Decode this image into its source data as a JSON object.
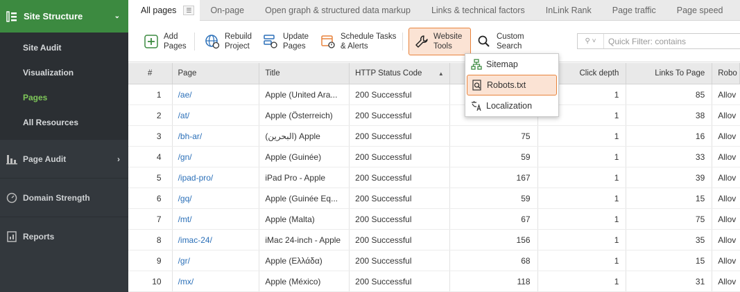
{
  "sidebar": {
    "header": "Site Structure",
    "sub_items": [
      {
        "label": "Site Audit",
        "active": false
      },
      {
        "label": "Visualization",
        "active": false
      },
      {
        "label": "Pages",
        "active": true
      },
      {
        "label": "All Resources",
        "active": false
      }
    ],
    "sections": [
      {
        "label": "Page Audit",
        "icon": "bar-chart-icon"
      },
      {
        "label": "Domain Strength",
        "icon": "gauge-icon"
      },
      {
        "label": "Reports",
        "icon": "report-icon"
      }
    ]
  },
  "tabs": [
    "All pages",
    "On-page",
    "Open graph & structured data markup",
    "Links & technical factors",
    "InLink Rank",
    "Page traffic",
    "Page speed"
  ],
  "toolbar": {
    "add": [
      "Add",
      "Pages"
    ],
    "rebuild": [
      "Rebuild",
      "Project"
    ],
    "update": [
      "Update",
      "Pages"
    ],
    "schedule": [
      "Schedule Tasks",
      "& Alerts"
    ],
    "website_tools": [
      "Website",
      "Tools"
    ],
    "custom_search": [
      "Custom",
      "Search"
    ],
    "filter_placeholder": "Quick Filter: contains"
  },
  "dropdown": {
    "items": [
      {
        "label": "Sitemap",
        "icon": "sitemap-icon"
      },
      {
        "label": "Robots.txt",
        "icon": "robots-file-icon",
        "highlighted": true
      },
      {
        "label": "Localization",
        "icon": "translate-icon"
      }
    ]
  },
  "table": {
    "headers": {
      "num": "#",
      "page": "Page",
      "title": "Title",
      "http": "HTTP Status Code",
      "depth": "Click depth",
      "links": "Links To Page",
      "robots": "Robo"
    },
    "rows": [
      {
        "num": "1",
        "page": "/ae/",
        "title": "Apple (United Ara...",
        "http": "200 Successful",
        "load": "",
        "depth": "1",
        "links": "85",
        "robots": "Allov"
      },
      {
        "num": "2",
        "page": "/at/",
        "title": "Apple (Österreich)",
        "http": "200 Successful",
        "load": "",
        "depth": "1",
        "links": "38",
        "robots": "Allov"
      },
      {
        "num": "3",
        "page": "/bh-ar/",
        "title": "(البحرين) Apple",
        "http": "200 Successful",
        "load": "75",
        "depth": "1",
        "links": "16",
        "robots": "Allov"
      },
      {
        "num": "4",
        "page": "/gn/",
        "title": "Apple (Guinée)",
        "http": "200 Successful",
        "load": "59",
        "depth": "1",
        "links": "33",
        "robots": "Allov"
      },
      {
        "num": "5",
        "page": "/ipad-pro/",
        "title": "iPad Pro - Apple",
        "http": "200 Successful",
        "load": "167",
        "depth": "1",
        "links": "39",
        "robots": "Allov"
      },
      {
        "num": "6",
        "page": "/gq/",
        "title": "Apple (Guinée Eq...",
        "http": "200 Successful",
        "load": "59",
        "depth": "1",
        "links": "15",
        "robots": "Allov"
      },
      {
        "num": "7",
        "page": "/mt/",
        "title": "Apple (Malta)",
        "http": "200 Successful",
        "load": "67",
        "depth": "1",
        "links": "75",
        "robots": "Allov"
      },
      {
        "num": "8",
        "page": "/imac-24/",
        "title": "iMac 24-inch - Apple",
        "http": "200 Successful",
        "load": "156",
        "depth": "1",
        "links": "35",
        "robots": "Allov"
      },
      {
        "num": "9",
        "page": "/gr/",
        "title": "Apple (Ελλάδα)",
        "http": "200 Successful",
        "load": "68",
        "depth": "1",
        "links": "15",
        "robots": "Allov"
      },
      {
        "num": "10",
        "page": "/mx/",
        "title": "Apple (México)",
        "http": "200 Successful",
        "load": "118",
        "depth": "1",
        "links": "31",
        "robots": "Allov"
      }
    ]
  },
  "colors": {
    "accent_green": "#3c8a40",
    "highlight_orange": "#e8823b",
    "highlight_fill": "#fbe3d4",
    "link_blue": "#2a6fb8"
  }
}
